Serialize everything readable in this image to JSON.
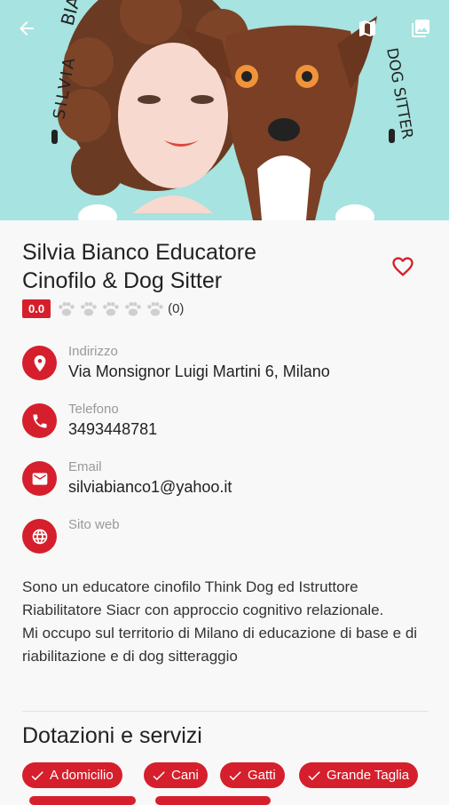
{
  "hero": {
    "artwork_left_text": "SILVIA",
    "artwork_top_text": "BIA",
    "artwork_right_text": "DOG SITTER"
  },
  "listing": {
    "title_line1": "Silvia Bianco Educatore",
    "title_line2": "Cinofilo & Dog Sitter",
    "rating_score": "0.0",
    "rating_paws": 5,
    "rating_count": "(0)"
  },
  "contacts": [
    {
      "label": "Indirizzo",
      "value": "Via Monsignor Luigi Martini 6, Milano",
      "icon": "location-pin-icon"
    },
    {
      "label": "Telefono",
      "value": "3493448781",
      "icon": "phone-icon"
    },
    {
      "label": "Email",
      "value": "silviabianco1@yahoo.it",
      "icon": "email-icon"
    },
    {
      "label": "Sito web",
      "value": "",
      "icon": "globe-icon"
    }
  ],
  "description": {
    "para1": "Sono un educatore cinofilo Think Dog ed Istruttore Riabilitatore Siacr con approccio cognitivo relazionale.",
    "para2": "Mi occupo sul territorio di Milano di educazione di base e di riabilitazione e di dog sitteraggio"
  },
  "services": {
    "title": "Dotazioni e servizi",
    "chips": [
      "A domicilio",
      "Cani",
      "Gatti",
      "Grande Taglia"
    ]
  },
  "colors": {
    "accent": "#d61f2c",
    "hero_bg": "#a7e3e0"
  }
}
